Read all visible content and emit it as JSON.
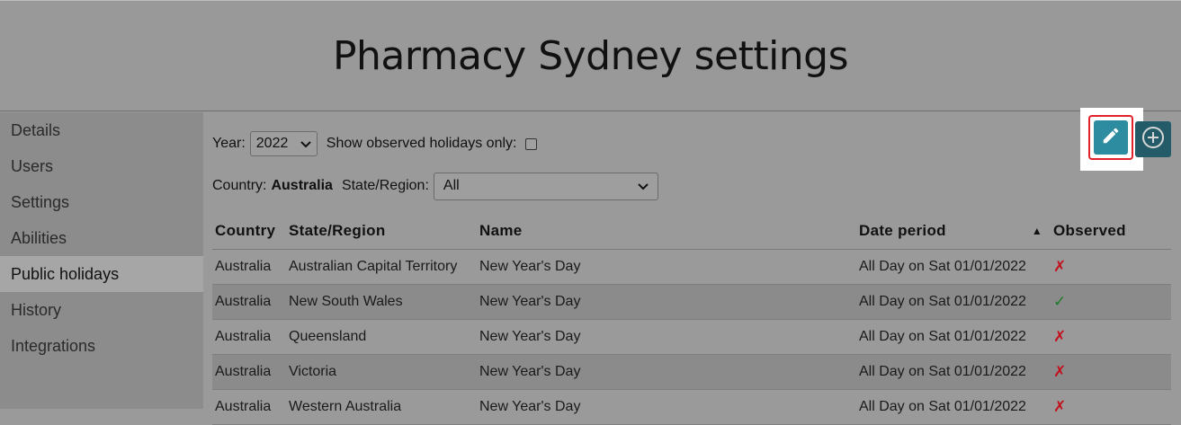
{
  "header": {
    "title": "Pharmacy Sydney settings"
  },
  "sidebar": {
    "items": [
      {
        "label": "Details"
      },
      {
        "label": "Users"
      },
      {
        "label": "Settings"
      },
      {
        "label": "Abilities"
      },
      {
        "label": "Public holidays"
      },
      {
        "label": "History"
      },
      {
        "label": "Integrations"
      }
    ],
    "active": "Public holidays"
  },
  "filters": {
    "year_label": "Year:",
    "year_value": "2022",
    "observed_only_label": "Show observed holidays only:",
    "observed_only_checked": false,
    "country_label": "Country:",
    "country_value": "Australia",
    "state_label": "State/Region:",
    "state_value": "All"
  },
  "toolbar": {
    "edit_icon": "pencil-icon",
    "add_icon": "plus-circle-icon"
  },
  "table": {
    "headers": {
      "country": "Country",
      "state": "State/Region",
      "name": "Name",
      "date": "Date period",
      "observed": "Observed"
    },
    "sort_indicator": "▲",
    "rows": [
      {
        "country": "Australia",
        "state": "Australian Capital Territory",
        "name": "New Year's Day",
        "date": "All Day on Sat 01/01/2022",
        "observed": "✗"
      },
      {
        "country": "Australia",
        "state": "New South Wales",
        "name": "New Year's Day",
        "date": "All Day on Sat 01/01/2022",
        "observed": "✓"
      },
      {
        "country": "Australia",
        "state": "Queensland",
        "name": "New Year's Day",
        "date": "All Day on Sat 01/01/2022",
        "observed": "✗"
      },
      {
        "country": "Australia",
        "state": "Victoria",
        "name": "New Year's Day",
        "date": "All Day on Sat 01/01/2022",
        "observed": "✗"
      },
      {
        "country": "Australia",
        "state": "Western Australia",
        "name": "New Year's Day",
        "date": "All Day on Sat 01/01/2022",
        "observed": "✗"
      }
    ]
  },
  "colors": {
    "accent": "#2e8ca0",
    "add_button": "#235c68",
    "highlight": "#e2212b",
    "no_mark": "#c2101c",
    "yes_mark": "#1d7a2a"
  }
}
